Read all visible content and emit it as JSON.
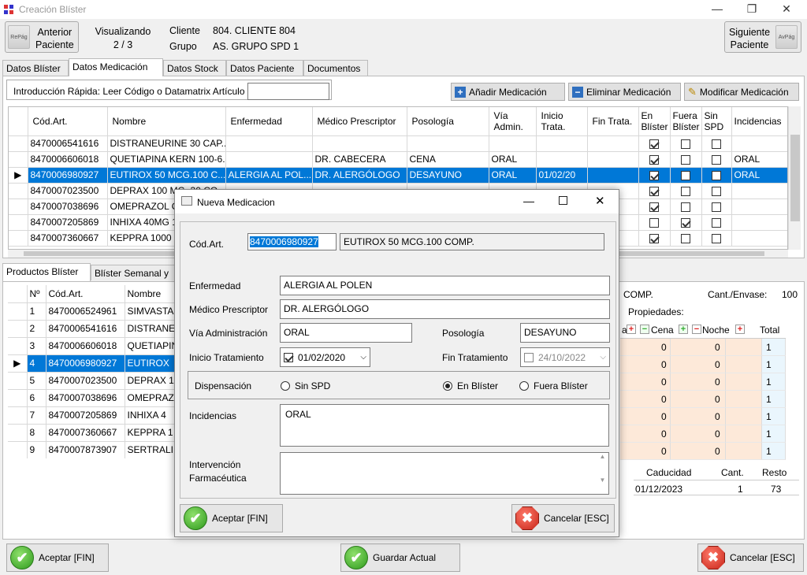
{
  "window": {
    "title": "Creación Blíster",
    "minimize": "—",
    "restore": "❐",
    "close": "✕"
  },
  "nav": {
    "prev_line1": "Anterior",
    "prev_line2": "Paciente",
    "prev_key": "RePág",
    "next_line1": "Siguiente",
    "next_line2": "Paciente",
    "next_key": "AvPág",
    "viewing_label": "Visualizando",
    "viewing_value": "2 / 3",
    "client_label": "Cliente",
    "client_value": "804. CLIENTE 804",
    "group_label": "Grupo",
    "group_value": "AS. GRUPO SPD 1"
  },
  "tabs": [
    "Datos Blíster",
    "Datos Medicación",
    "Datos Stock",
    "Datos Paciente",
    "Documentos"
  ],
  "med_panel": {
    "quick_entry_label": "Introducción Rápida: Leer Código o Datamatrix Artículo",
    "quick_entry_value": "",
    "add_button": "Añadir Medicación",
    "remove_button": "Eliminar Medicación",
    "modify_button": "Modificar Medicación",
    "columns": [
      "Cód.Art.",
      "Nombre",
      "Enfermedad",
      "Médico Prescriptor",
      "Posología",
      "Vía Admin.",
      "Inicio Trata.",
      "Fin Trata.",
      "En Blíster",
      "Fuera Blíster",
      "Sin SPD",
      "Incidencias"
    ],
    "rows": [
      {
        "code": "8470006541616",
        "name": "DISTRANEURINE  30 CAP...",
        "disease": "",
        "doctor": "",
        "dosage": "",
        "route": "",
        "start": "",
        "end": "",
        "in": true,
        "out": false,
        "nospd": false,
        "incid": "",
        "selected": false
      },
      {
        "code": "8470006606018",
        "name": "QUETIAPINA KERN 100-6...",
        "disease": "",
        "doctor": "DR. CABECERA",
        "dosage": "CENA",
        "route": "ORAL",
        "start": "",
        "end": "",
        "in": true,
        "out": false,
        "nospd": false,
        "incid": "ORAL",
        "selected": false
      },
      {
        "code": "8470006980927",
        "name": "EUTIROX  50 MCG.100 C...",
        "disease": "ALERGIA AL POL...",
        "doctor": "DR. ALERGÓLOGO",
        "dosage": "DESAYUNO",
        "route": "ORAL",
        "start": "01/02/20",
        "end": "",
        "in": true,
        "out": false,
        "nospd": false,
        "incid": "ORAL",
        "selected": true
      },
      {
        "code": "8470007023500",
        "name": "DEPRAX 100 MG. 30 CO...",
        "disease": "",
        "doctor": "",
        "dosage": "",
        "route": "",
        "start": "",
        "end": "",
        "in": true,
        "out": false,
        "nospd": false,
        "incid": "",
        "selected": false
      },
      {
        "code": "8470007038696",
        "name": "OMEPRAZOL CINFA 20 ...",
        "disease": "",
        "doctor": "",
        "dosage": "",
        "route": "",
        "start": "",
        "end": "",
        "in": true,
        "out": false,
        "nospd": false,
        "incid": "",
        "selected": false
      },
      {
        "code": "8470007205869",
        "name": "INHIXA  40MG 10 JERIN...",
        "disease": "",
        "doctor": "",
        "dosage": "",
        "route": "",
        "start": "",
        "end": "",
        "in": false,
        "out": true,
        "nospd": false,
        "incid": "",
        "selected": false
      },
      {
        "code": "8470007360667",
        "name": "KEPPRA 1000 MG 30 CO...",
        "disease": "",
        "doctor": "",
        "dosage": "",
        "route": "",
        "start": "",
        "end": "",
        "in": true,
        "out": false,
        "nospd": false,
        "incid": "",
        "selected": false
      }
    ]
  },
  "lower_tabs": [
    "Productos Blíster",
    "Blíster Semanal y"
  ],
  "products": {
    "columns": [
      "Nº",
      "Cód.Art.",
      "Nombre"
    ],
    "rows": [
      {
        "n": "1",
        "code": "8470006524961",
        "name": "SIMVASTA",
        "selected": false
      },
      {
        "n": "2",
        "code": "8470006541616",
        "name": "DISTRANE",
        "selected": false
      },
      {
        "n": "3",
        "code": "8470006606018",
        "name": "QUETIAPIN",
        "selected": false
      },
      {
        "n": "4",
        "code": "8470006980927",
        "name": "EUTIROX",
        "selected": true
      },
      {
        "n": "5",
        "code": "8470007023500",
        "name": "DEPRAX 1",
        "selected": false
      },
      {
        "n": "6",
        "code": "8470007038696",
        "name": "OMEPRAZ",
        "selected": false
      },
      {
        "n": "7",
        "code": "8470007205869",
        "name": "INHIXA  4",
        "selected": false
      },
      {
        "n": "8",
        "code": "8470007360667",
        "name": "KEPPRA 1",
        "selected": false
      },
      {
        "n": "9",
        "code": "8470007873907",
        "name": "SERTRALIN",
        "selected": false
      }
    ]
  },
  "right_info": {
    "product_suffix": "COMP.",
    "units_label": "Cant./Envase:",
    "units_value": "100",
    "properties_label": "Propiedades:",
    "schedule_cols": [
      "a",
      "Cena",
      "Noche",
      "Total"
    ],
    "schedule_rows": [
      [
        "0",
        "0",
        "1"
      ],
      [
        "0",
        "0",
        "1"
      ],
      [
        "0",
        "0",
        "1"
      ],
      [
        "0",
        "0",
        "1"
      ],
      [
        "0",
        "0",
        "1"
      ],
      [
        "0",
        "0",
        "1"
      ],
      [
        "0",
        "0",
        "1"
      ]
    ],
    "stock_cols": [
      "Caducidad",
      "Cant.",
      "Resto"
    ],
    "stock_rows": [
      [
        "01/12/2023",
        "1",
        "73"
      ]
    ]
  },
  "dialog": {
    "title": "Nueva Medicacion",
    "code_label": "Cód.Art.",
    "code_value": "8470006980927",
    "product_name": "EUTIROX  50 MCG.100 COMP.",
    "disease_label": "Enfermedad",
    "disease_value": "ALERGIA AL POLEN",
    "doctor_label": "Médico Prescriptor",
    "doctor_value": "DR. ALERGÓLOGO",
    "route_label": "Vía Administración",
    "route_value": "ORAL",
    "dosage_label": "Posología",
    "dosage_value": "DESAYUNO",
    "start_label": "Inicio Tratamiento",
    "start_value": "01/02/2020",
    "end_label": "Fin Tratamiento",
    "end_value": "24/10/2022",
    "dispensation_label": "Dispensación",
    "opt_no_spd": "Sin SPD",
    "opt_in": "En Blíster",
    "opt_out": "Fuera Blíster",
    "incidents_label": "Incidencias",
    "incidents_value": "ORAL",
    "intervention_label_1": "Intervención",
    "intervention_label_2": "Farmacéutica",
    "intervention_value": "",
    "accept": "Aceptar [FIN]",
    "cancel": "Cancelar [ESC]"
  },
  "footer": {
    "accept": "Aceptar [FIN]",
    "save": "Guardar Actual",
    "cancel": "Cancelar [ESC]"
  }
}
